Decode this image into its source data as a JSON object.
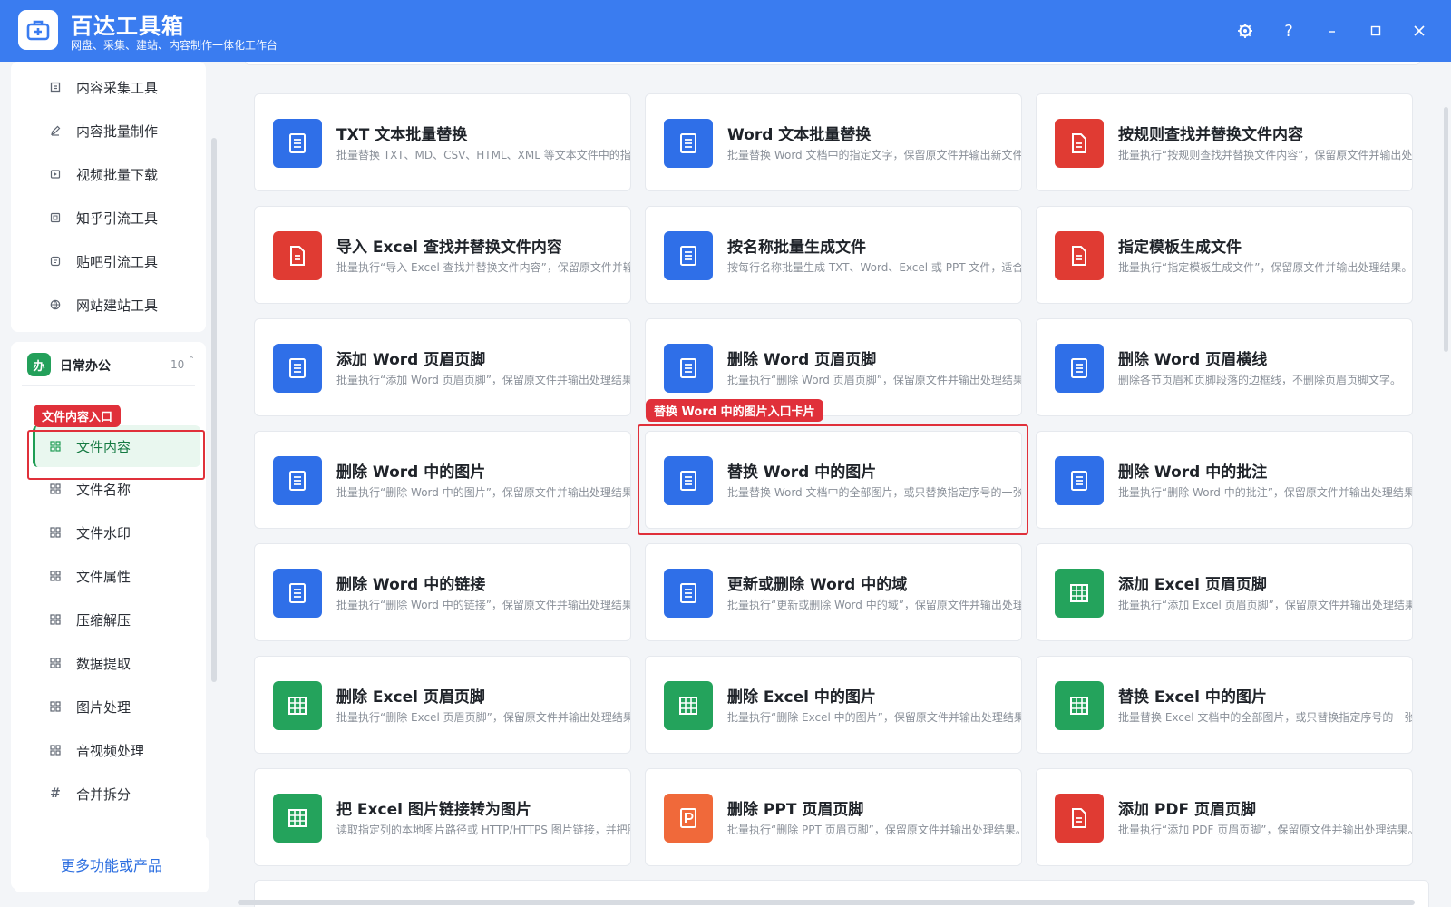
{
  "app": {
    "title": "百达工具箱",
    "subtitle": "网盘、采集、建站、内容制作一体化工作台"
  },
  "window_controls": [
    "settings-icon",
    "help-icon",
    "minimize-icon",
    "maximize-icon",
    "close-icon"
  ],
  "sidebar": {
    "top_items": [
      {
        "label": "内容采集工具",
        "icon": "document-icon"
      },
      {
        "label": "内容批量制作",
        "icon": "pen-icon"
      },
      {
        "label": "视频批量下载",
        "icon": "video-icon"
      },
      {
        "label": "知乎引流工具",
        "icon": "zhihu-icon"
      },
      {
        "label": "贴吧引流工具",
        "icon": "tieba-icon"
      },
      {
        "label": "网站建站工具",
        "icon": "globe-icon"
      }
    ],
    "group": {
      "badge": "办",
      "label": "日常办公",
      "count": "10",
      "caret": "˄"
    },
    "items": [
      {
        "label": "文件内容",
        "icon": "grid-icon",
        "active": true
      },
      {
        "label": "文件名称",
        "icon": "grid-icon"
      },
      {
        "label": "文件水印",
        "icon": "grid-icon"
      },
      {
        "label": "文件属性",
        "icon": "grid-icon"
      },
      {
        "label": "压缩解压",
        "icon": "grid-icon"
      },
      {
        "label": "数据提取",
        "icon": "grid-icon"
      },
      {
        "label": "图片处理",
        "icon": "grid-icon"
      },
      {
        "label": "音视频处理",
        "icon": "grid-icon"
      },
      {
        "label": "合并拆分",
        "icon": "hash-icon"
      }
    ],
    "more_label": "更多功能或产品"
  },
  "annotations": {
    "sidebar_tag": "文件内容入口",
    "card_tag": "替换 Word 中的图片入口卡片"
  },
  "colors": {
    "blue": "#2f6fe8",
    "red": "#e03b33",
    "green": "#24a35c",
    "orange": "#f0693a"
  },
  "cards": [
    {
      "title": "TXT 文本批量替换",
      "desc": "批量替换 TXT、MD、CSV、HTML、XML 等文本文件中的指定内",
      "color": "blue",
      "icon": "doc-icon"
    },
    {
      "title": "Word 文本批量替换",
      "desc": "批量替换 Word 文档中的指定文字，保留原文件并输出新文件。",
      "color": "blue",
      "icon": "doc-icon"
    },
    {
      "title": "按规则查找并替换文件内容",
      "desc": "批量执行“按规则查找并替换文件内容”，保留原文件并输出处理结果",
      "color": "red",
      "icon": "file-icon"
    },
    {
      "title": "导入 Excel 查找并替换文件内容",
      "desc": "批量执行“导入 Excel 查找并替换文件内容”，保留原文件并输出处",
      "color": "red",
      "icon": "file-icon"
    },
    {
      "title": "按名称批量生成文件",
      "desc": "按每行名称批量生成 TXT、Word、Excel 或 PPT 文件，适合批量",
      "color": "blue",
      "icon": "doc-icon"
    },
    {
      "title": "指定模板生成文件",
      "desc": "批量执行“指定模板生成文件”，保留原文件并输出处理结果。",
      "color": "red",
      "icon": "file-icon"
    },
    {
      "title": "添加 Word 页眉页脚",
      "desc": "批量执行“添加 Word 页眉页脚”，保留原文件并输出处理结果。",
      "color": "blue",
      "icon": "doc-icon"
    },
    {
      "title": "删除 Word 页眉页脚",
      "desc": "批量执行“删除 Word 页眉页脚”，保留原文件并输出处理结果。",
      "color": "blue",
      "icon": "doc-icon"
    },
    {
      "title": "删除 Word 页眉横线",
      "desc": "删除各节页眉和页脚段落的边框线，不删除页眉页脚文字。",
      "color": "blue",
      "icon": "doc-icon"
    },
    {
      "title": "删除 Word 中的图片",
      "desc": "批量执行“删除 Word 中的图片”，保留原文件并输出处理结果。",
      "color": "blue",
      "icon": "doc-icon"
    },
    {
      "title": "替换 Word 中的图片",
      "desc": "批量替换 Word 文档中的全部图片，或只替换指定序号的一张图片",
      "color": "blue",
      "icon": "doc-icon"
    },
    {
      "title": "删除 Word 中的批注",
      "desc": "批量执行“删除 Word 中的批注”，保留原文件并输出处理结果。",
      "color": "blue",
      "icon": "doc-icon"
    },
    {
      "title": "删除 Word 中的链接",
      "desc": "批量执行“删除 Word 中的链接”，保留原文件并输出处理结果。",
      "color": "blue",
      "icon": "doc-icon"
    },
    {
      "title": "更新或删除 Word 中的域",
      "desc": "批量执行“更新或删除 Word 中的域”，保留原文件并输出处理结果",
      "color": "blue",
      "icon": "doc-icon"
    },
    {
      "title": "添加 Excel 页眉页脚",
      "desc": "批量执行“添加 Excel 页眉页脚”，保留原文件并输出处理结果。",
      "color": "green",
      "icon": "sheet-icon"
    },
    {
      "title": "删除 Excel 页眉页脚",
      "desc": "批量执行“删除 Excel 页眉页脚”，保留原文件并输出处理结果。",
      "color": "green",
      "icon": "sheet-icon"
    },
    {
      "title": "删除 Excel 中的图片",
      "desc": "批量执行“删除 Excel 中的图片”，保留原文件并输出处理结果。",
      "color": "green",
      "icon": "sheet-icon"
    },
    {
      "title": "替换 Excel 中的图片",
      "desc": "批量替换 Excel 文档中的全部图片，或只替换指定序号的一张图片。",
      "color": "green",
      "icon": "sheet-icon"
    },
    {
      "title": "把 Excel 图片链接转为图片",
      "desc": "读取指定列的本地图片路径或 HTTP/HTTPS 图片链接，并把图片",
      "color": "green",
      "icon": "sheet-icon"
    },
    {
      "title": "删除 PPT 页眉页脚",
      "desc": "批量执行“删除 PPT 页眉页脚”，保留原文件并输出处理结果。",
      "color": "orange",
      "icon": "ppt-icon"
    },
    {
      "title": "添加 PDF 页眉页脚",
      "desc": "批量执行“添加 PDF 页眉页脚”，保留原文件并输出处理结果。",
      "color": "red",
      "icon": "pdf-icon"
    }
  ]
}
